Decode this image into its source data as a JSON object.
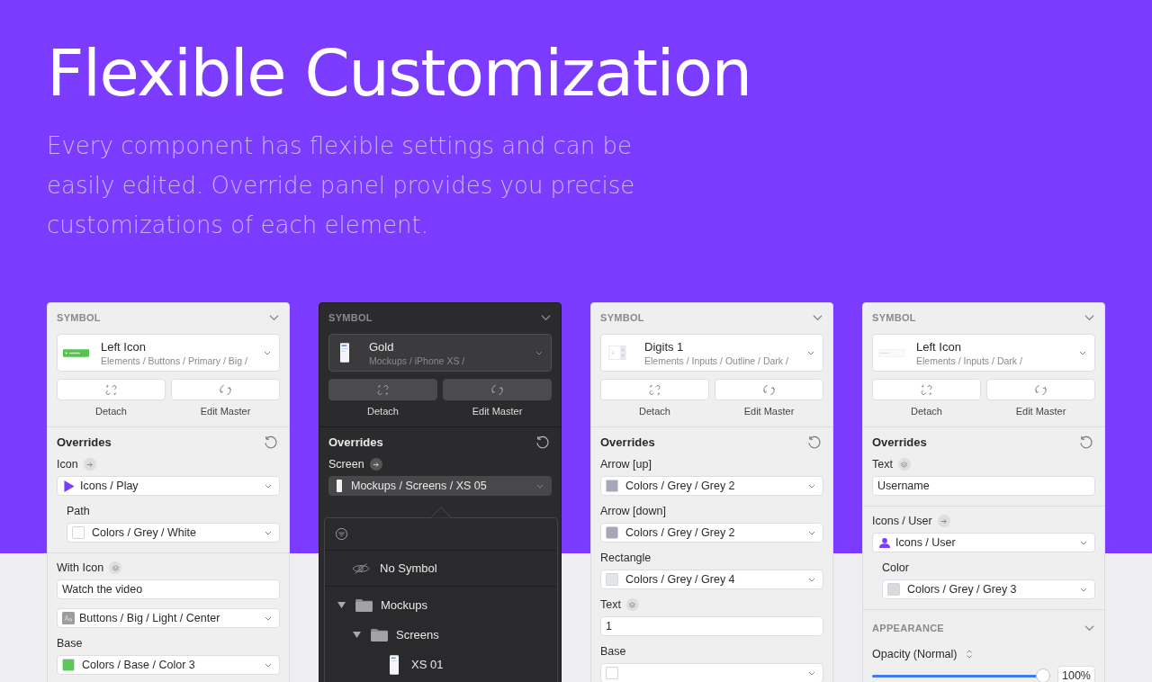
{
  "headline": "Flexible Customization",
  "intro": "Every component has flexible settings and can be easily edited. Override panel provides you precise customizations of each element.",
  "panels": [
    {
      "kind": "light",
      "symbol": {
        "kind": "button",
        "title": "SYMBOL",
        "name": "Left Icon",
        "path": "Elements / Buttons / Primary / Big /"
      },
      "actions": [
        {
          "kind": "detach",
          "label": "Detach"
        },
        {
          "kind": "sync",
          "label": "Edit Master"
        }
      ],
      "overrides": "Overrides",
      "rows": [
        {
          "kind": "field",
          "label": "Icon",
          "badge": {
            "kind": "arrow"
          },
          "controls": [
            {
              "kind": "dropdown",
              "icon": {
                "kind": "play"
              },
              "value": "Icons / Play"
            }
          ],
          "children": [
            {
              "kind": "field",
              "label": "Path",
              "controls": [
                {
                  "kind": "dropdown",
                  "color": "#ffffff",
                  "value": "Colors / Grey / White"
                }
              ]
            }
          ]
        },
        {
          "kind": "divider"
        },
        {
          "kind": "field",
          "label": "With Icon",
          "badge": {
            "kind": "layers"
          },
          "controls": [
            {
              "kind": "input",
              "value": "Watch the video"
            },
            {
              "kind": "dropdown",
              "icon": {
                "kind": "text-style"
              },
              "value": "Buttons / Big / Light / Center"
            }
          ]
        },
        {
          "kind": "field",
          "label": "Base",
          "controls": [
            {
              "kind": "dropdown",
              "color": "#5cc85a",
              "value": "Colors / Base / Color 3"
            }
          ]
        }
      ]
    },
    {
      "kind": "dark",
      "symbol": {
        "kind": "phone",
        "title": "SYMBOL",
        "name": "Gold",
        "path": "Mockups / iPhone XS /"
      },
      "actions": [
        {
          "kind": "detach",
          "label": "Detach"
        },
        {
          "kind": "sync",
          "label": "Edit Master"
        }
      ],
      "overrides": "Overrides",
      "rows": [
        {
          "kind": "field",
          "label": "Screen",
          "badge": {
            "kind": "arrow"
          },
          "controls": [
            {
              "kind": "dropdown",
              "icon": {
                "kind": "screen"
              },
              "value": "Mockups / Screens / XS 05"
            }
          ]
        }
      ],
      "popup": {
        "empty_option": "No Symbol",
        "tree": [
          {
            "kind": "folder",
            "label": "Mockups",
            "expanded": true,
            "children": [
              {
                "kind": "folder",
                "label": "Screens",
                "expanded": true,
                "children": [
                  {
                    "kind": "phone",
                    "label": "XS 01"
                  }
                ]
              }
            ]
          }
        ]
      }
    },
    {
      "kind": "light",
      "symbol": {
        "kind": "stepper",
        "title": "SYMBOL",
        "name": "Digits 1",
        "path": "Elements / Inputs / Outline / Dark /"
      },
      "actions": [
        {
          "kind": "detach",
          "label": "Detach"
        },
        {
          "kind": "sync",
          "label": "Edit Master"
        }
      ],
      "overrides": "Overrides",
      "rows": [
        {
          "kind": "field",
          "label": "Arrow [up]",
          "controls": [
            {
              "kind": "dropdown",
              "color": "#a6a7b9",
              "value": "Colors / Grey / Grey 2"
            }
          ]
        },
        {
          "kind": "field",
          "label": "Arrow [down]",
          "controls": [
            {
              "kind": "dropdown",
              "color": "#a6a7b9",
              "value": "Colors / Grey / Grey 2"
            }
          ]
        },
        {
          "kind": "field",
          "label": "Rectangle",
          "controls": [
            {
              "kind": "dropdown",
              "color": "#e2e4eb",
              "value": "Colors / Grey / Grey 4"
            }
          ]
        },
        {
          "kind": "field",
          "label": "Text",
          "badge": {
            "kind": "layers"
          },
          "controls": [
            {
              "kind": "input",
              "value": "1"
            }
          ]
        },
        {
          "kind": "field",
          "label": "Base",
          "controls": [
            {
              "kind": "dropdown",
              "color": "#ffffff"
            }
          ]
        }
      ]
    },
    {
      "kind": "light",
      "symbol": {
        "kind": "input",
        "title": "SYMBOL",
        "name": "Left Icon",
        "path": "Elements / Inputs / Dark /"
      },
      "actions": [
        {
          "kind": "detach",
          "label": "Detach"
        },
        {
          "kind": "sync",
          "label": "Edit Master"
        }
      ],
      "overrides": "Overrides",
      "rows": [
        {
          "kind": "field",
          "label": "Text",
          "badge": {
            "kind": "layers"
          },
          "controls": [
            {
              "kind": "input",
              "value": "Username"
            }
          ]
        },
        {
          "kind": "divider"
        },
        {
          "kind": "field",
          "label": "Icons / User",
          "badge": {
            "kind": "arrow"
          },
          "controls": [
            {
              "kind": "dropdown",
              "icon": {
                "kind": "user"
              },
              "value": "Icons / User"
            }
          ],
          "children": [
            {
              "kind": "field",
              "label": "Color",
              "controls": [
                {
                  "kind": "dropdown",
                  "color": "#d8dae1",
                  "value": "Colors / Grey / Grey 3"
                }
              ]
            }
          ]
        },
        {
          "kind": "divider"
        },
        {
          "kind": "section",
          "title": "APPEARANCE"
        },
        {
          "kind": "slider",
          "label": "Opacity (Normal)",
          "level": 1,
          "reading": "100%"
        }
      ]
    }
  ]
}
